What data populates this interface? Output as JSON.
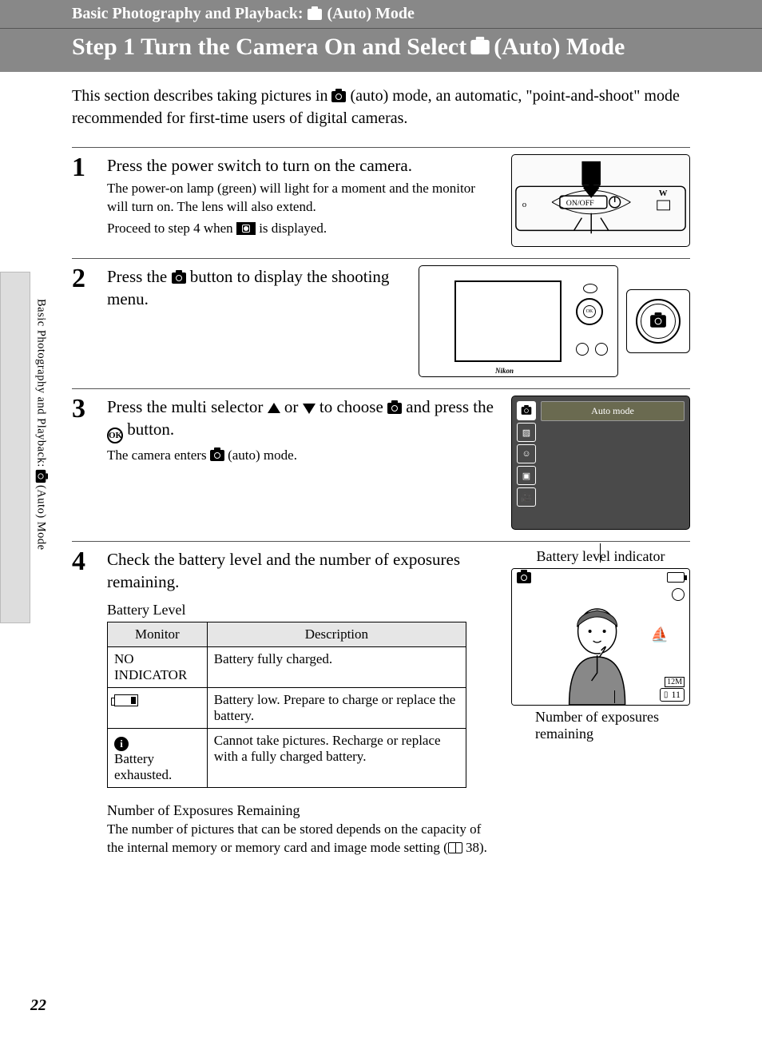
{
  "header": {
    "breadcrumb_pre": "Basic Photography and Playback:",
    "breadcrumb_post": "(Auto) Mode",
    "title_pre": "Step 1 Turn the Camera On and Select",
    "title_post": "(Auto) Mode"
  },
  "intro": {
    "pre": "This section describes taking pictures in ",
    "post": " (auto) mode, an automatic, \"point-and-shoot\" mode recommended for first-time users of digital cameras."
  },
  "steps": {
    "s1": {
      "num": "1",
      "head": "Press the power switch to turn on the camera.",
      "desc1": "The power-on lamp (green) will light for a moment and the monitor will turn on. The lens will also extend.",
      "desc2_pre": "Proceed to step 4 when ",
      "desc2_post": " is displayed.",
      "on_off": "ON/OFF"
    },
    "s2": {
      "num": "2",
      "head_pre": "Press the ",
      "head_post": " button to display the shooting menu."
    },
    "s3": {
      "num": "3",
      "head_pre": "Press the multi selector ",
      "head_mid": " or ",
      "head_mid2": " to choose ",
      "head_post": " and press the ",
      "head_end": " button.",
      "ok": "OK",
      "desc_pre": "The camera enters ",
      "desc_post": " (auto) mode.",
      "menu_label": "Auto mode"
    },
    "s4": {
      "num": "4",
      "head": "Check the battery level and the number of exposures remaining.",
      "battery_heading": "Battery Level",
      "table": {
        "col1": "Monitor",
        "col2": "Description",
        "r1c1": "NO INDICATOR",
        "r1c2": "Battery fully charged.",
        "r2c2": "Battery low. Prepare to charge or replace the battery.",
        "r3c1a": "Battery",
        "r3c1b": "exhausted.",
        "r3c2": "Cannot take pictures. Recharge or replace with a fully charged battery."
      },
      "right_label_top": "Battery level indicator",
      "right_label_bot1": "Number of exposures",
      "right_label_bot2": "remaining",
      "monitor_mode": "12M",
      "monitor_count": "11",
      "exposures_heading": "Number of Exposures Remaining",
      "exposures_text_pre": "The number of pictures that can be stored depends on the capacity of the internal memory or memory card and image mode setting (",
      "exposures_page": " 38).",
      "card_icon": "[  "
    }
  },
  "side": {
    "pre": "Basic Photography and Playback: ",
    "post": " (Auto) Mode"
  },
  "page": "22"
}
